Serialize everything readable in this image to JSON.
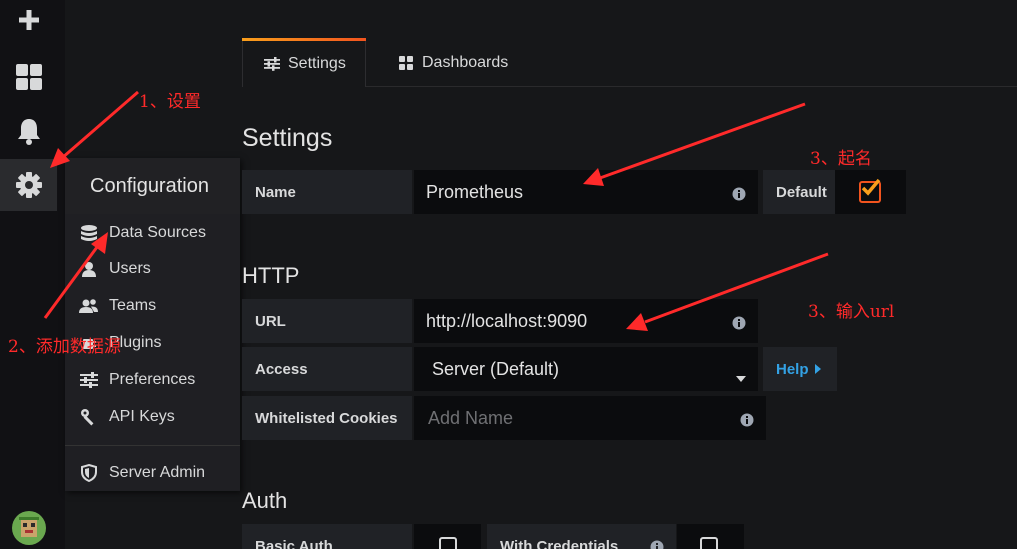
{
  "colors": {
    "accent": "#f2541e",
    "help": "#33a2e5",
    "annotation": "#ff2a2a"
  },
  "sidebar": {
    "icons": [
      "plus-icon",
      "dashboards-icon",
      "bell-icon",
      "gear-icon",
      "avatar"
    ]
  },
  "config_menu": {
    "title": "Configuration",
    "items": [
      {
        "label": "Data Sources",
        "icon": "database-icon"
      },
      {
        "label": "Users",
        "icon": "user-icon"
      },
      {
        "label": "Teams",
        "icon": "users-icon"
      },
      {
        "label": "Plugins",
        "icon": "plug-icon"
      },
      {
        "label": "Preferences",
        "icon": "sliders-icon"
      },
      {
        "label": "API Keys",
        "icon": "key-icon"
      }
    ],
    "server_admin": {
      "label": "Server Admin",
      "icon": "shield-icon"
    }
  },
  "tabs": [
    {
      "label": "Settings",
      "icon": "sliders-icon",
      "active": true
    },
    {
      "label": "Dashboards",
      "icon": "dashboards-icon",
      "active": false
    }
  ],
  "settings": {
    "heading": "Settings",
    "name_label": "Name",
    "name_value": "Prometheus",
    "default_label": "Default",
    "default_checked": true
  },
  "http": {
    "heading": "HTTP",
    "url_label": "URL",
    "url_value": "http://localhost:9090",
    "access_label": "Access",
    "access_value": "Server (Default)",
    "help_label": "Help",
    "cookies_label": "Whitelisted Cookies",
    "cookies_placeholder": "Add Name"
  },
  "auth": {
    "heading": "Auth",
    "basic_auth_label": "Basic Auth",
    "with_credentials_label": "With Credentials"
  },
  "annotations": {
    "a1": "1、设置",
    "a2": "2、添加数据源",
    "a3": "3、起名",
    "a4": "3、输入url"
  }
}
